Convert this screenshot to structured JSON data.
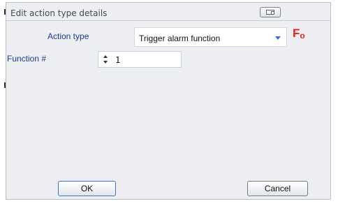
{
  "dialog": {
    "title": "Edit action type details",
    "title_button_icon": "window-restore-icon"
  },
  "form": {
    "action_type_label": "Action type",
    "action_type_value": "Trigger alarm function",
    "action_type_icon": "function-icon",
    "function_label": "Function #",
    "function_value": "1"
  },
  "buttons": {
    "ok_label": "OK",
    "cancel_label": "Cancel"
  },
  "colors": {
    "label_blue": "#1f3b8a",
    "dropdown_arrow": "#3a6fd0",
    "function_icon_red": "#e0261f",
    "dialog_bg": "#eceef1"
  }
}
